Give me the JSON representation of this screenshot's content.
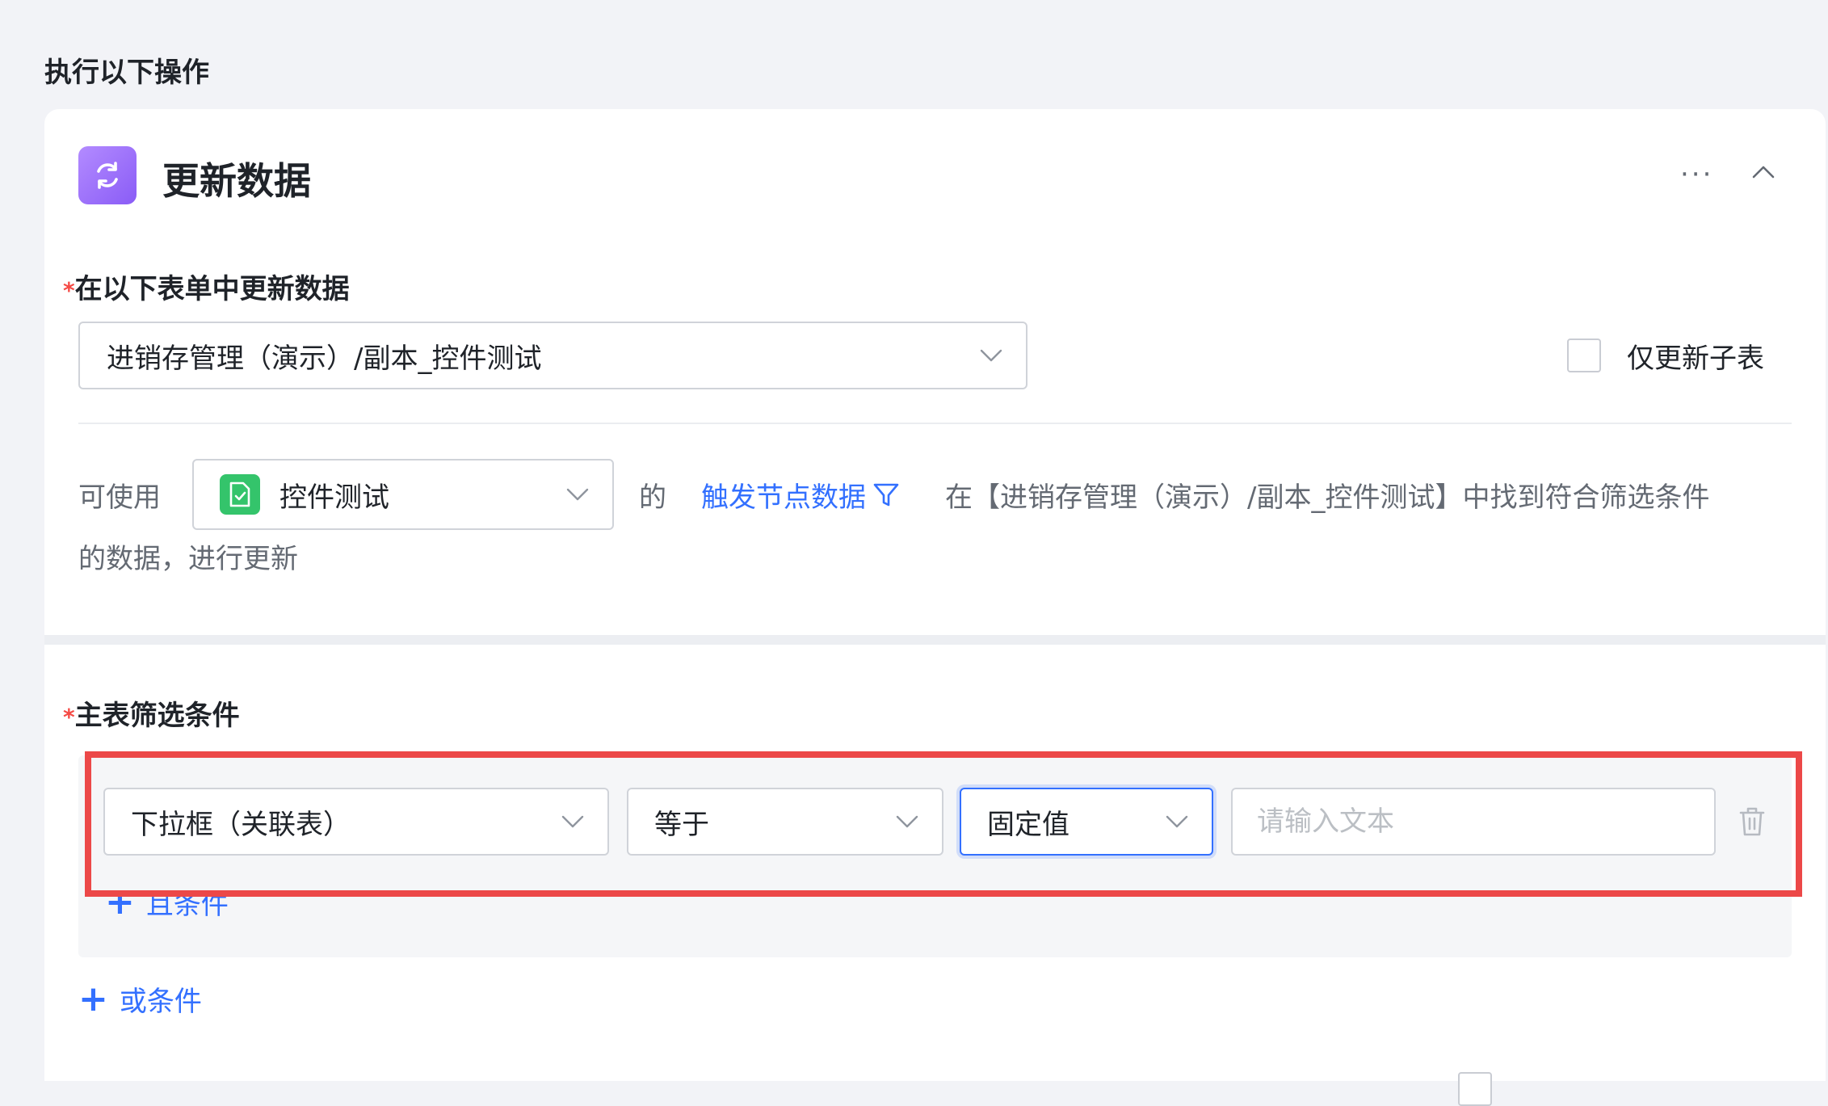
{
  "section": {
    "title": "执行以下操作"
  },
  "node": {
    "title": "更新数据",
    "icon": "refresh-icon",
    "more_label": "···",
    "accent": "#8a5cf6"
  },
  "target_form": {
    "label": "在以下表单中更新数据",
    "selected": "进销存管理（演示）/副本_控件测试",
    "sub_table_only_label": "仅更新子表",
    "sub_table_only_checked": false
  },
  "data_source": {
    "prefix": "可使用",
    "selected": "控件测试",
    "middle": "的",
    "trigger_link": "触发节点数据",
    "sentence_tail": "在【进销存管理（演示）/副本_控件测试】中找到符合筛选条件",
    "sentence_wrap": "的数据，进行更新"
  },
  "filter": {
    "label": "主表筛选条件",
    "condition": {
      "field": "下拉框（关联表）",
      "operator": "等于",
      "value_type": "固定值",
      "value_placeholder": "请输入文本",
      "value": ""
    },
    "add_and_label": "且条件",
    "add_or_label": "或条件"
  },
  "colors": {
    "link": "#3370ff",
    "required": "#f54a45",
    "highlight": "#ec4848",
    "source_icon": "#34c46b"
  }
}
